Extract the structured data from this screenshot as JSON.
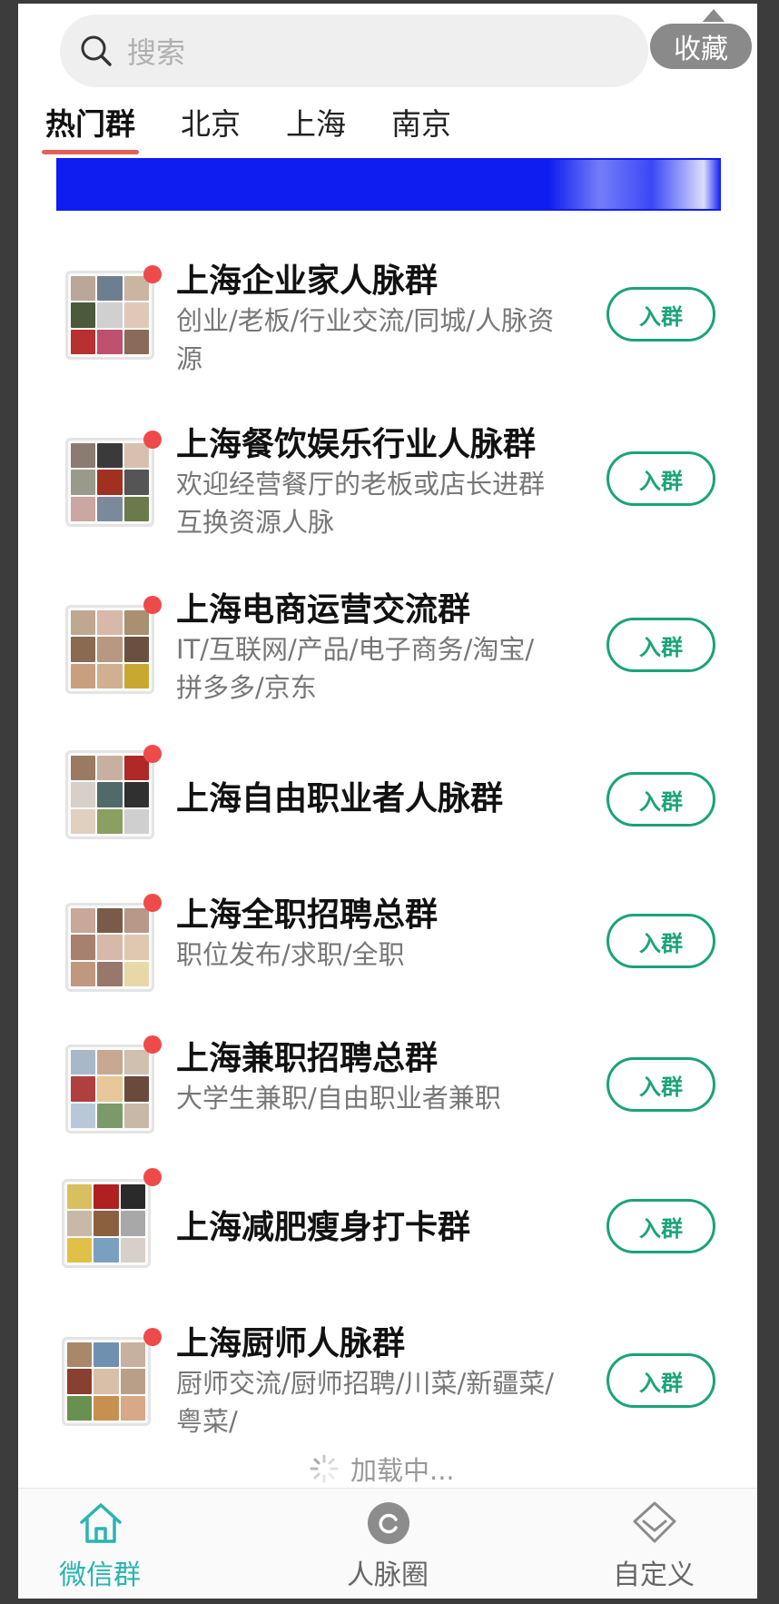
{
  "search": {
    "placeholder": "搜索"
  },
  "favorite": {
    "label": "收藏"
  },
  "tabs": [
    {
      "label": "热门群"
    },
    {
      "label": "北京"
    },
    {
      "label": "上海"
    },
    {
      "label": "南京"
    }
  ],
  "groups": [
    {
      "title": "上海企业家人脉群",
      "desc": "创业/老板/行业交流/同城/人脉资源",
      "button": "入群"
    },
    {
      "title": "上海餐饮娱乐行业人脉群",
      "desc": "欢迎经营餐厅的老板或店长进群互换资源人脉",
      "button": "入群"
    },
    {
      "title": "上海电商运营交流群",
      "desc": "IT/互联网/产品/电子商务/淘宝/拼多多/京东",
      "button": "入群"
    },
    {
      "title": "上海自由职业者人脉群",
      "desc": "",
      "button": "入群"
    },
    {
      "title": "上海全职招聘总群",
      "desc": "职位发布/求职/全职",
      "button": "入群"
    },
    {
      "title": "上海兼职招聘总群",
      "desc": "大学生兼职/自由职业者兼职",
      "button": "入群"
    },
    {
      "title": "上海减肥瘦身打卡群",
      "desc": "",
      "button": "入群"
    },
    {
      "title": "上海厨师人脉群",
      "desc": "厨师交流/厨师招聘/川菜/新疆菜/粤菜/",
      "button": "入群"
    }
  ],
  "loading": {
    "label": "加载中..."
  },
  "bottom_nav": [
    {
      "label": "微信群",
      "icon": "home-icon"
    },
    {
      "label": "人脉圈",
      "icon": "circle-icon"
    },
    {
      "label": "自定义",
      "icon": "diamond-icon"
    }
  ],
  "colors": {
    "accent_green": "#1aa37a",
    "nav_active": "#2ab4b0",
    "tab_indicator": "#e2625a",
    "badge_red": "#ef4a4a",
    "banner_blue": "#0f1df0"
  }
}
